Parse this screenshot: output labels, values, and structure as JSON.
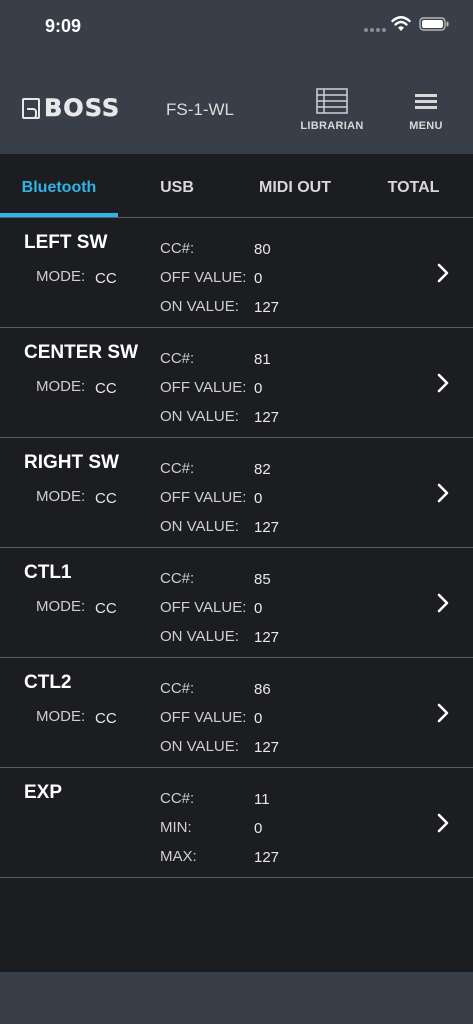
{
  "status_bar": {
    "time": "9:09"
  },
  "header": {
    "logo_text": "BOSS",
    "device_name": "FS-1-WL",
    "librarian_label": "LIBRARIAN",
    "menu_label": "MENU"
  },
  "tabs": [
    {
      "label": "Bluetooth",
      "active": true
    },
    {
      "label": "USB",
      "active": false
    },
    {
      "label": "MIDI OUT",
      "active": false
    },
    {
      "label": "TOTAL",
      "active": false
    }
  ],
  "rows": [
    {
      "name": "LEFT SW",
      "mode_label": "MODE:",
      "mode_value": "CC",
      "p1_label": "CC#:",
      "p1_value": "80",
      "p2_label": "OFF VALUE:",
      "p2_value": "0",
      "p3_label": "ON VALUE:",
      "p3_value": "127"
    },
    {
      "name": "CENTER SW",
      "mode_label": "MODE:",
      "mode_value": "CC",
      "p1_label": "CC#:",
      "p1_value": "81",
      "p2_label": "OFF VALUE:",
      "p2_value": "0",
      "p3_label": "ON VALUE:",
      "p3_value": "127"
    },
    {
      "name": "RIGHT SW",
      "mode_label": "MODE:",
      "mode_value": "CC",
      "p1_label": "CC#:",
      "p1_value": "82",
      "p2_label": "OFF VALUE:",
      "p2_value": "0",
      "p3_label": "ON VALUE:",
      "p3_value": "127"
    },
    {
      "name": "CTL1",
      "mode_label": "MODE:",
      "mode_value": "CC",
      "p1_label": "CC#:",
      "p1_value": "85",
      "p2_label": "OFF VALUE:",
      "p2_value": "0",
      "p3_label": "ON VALUE:",
      "p3_value": "127"
    },
    {
      "name": "CTL2",
      "mode_label": "MODE:",
      "mode_value": "CC",
      "p1_label": "CC#:",
      "p1_value": "86",
      "p2_label": "OFF VALUE:",
      "p2_value": "0",
      "p3_label": "ON VALUE:",
      "p3_value": "127"
    },
    {
      "name": "EXP",
      "mode_label": "",
      "mode_value": "",
      "p1_label": "CC#:",
      "p1_value": "11",
      "p2_label": "MIN:",
      "p2_value": "0",
      "p3_label": "MAX:",
      "p3_value": "127"
    }
  ],
  "colors": {
    "accent": "#2fb4e6",
    "header_bg": "#383f48",
    "body_bg": "#1c1d20",
    "divider": "#5a5d63"
  },
  "icons": {
    "wifi": "wifi-icon",
    "battery": "battery-icon",
    "librarian": "list-icon",
    "menu": "hamburger-icon",
    "row_action": "chevron-right-icon"
  }
}
